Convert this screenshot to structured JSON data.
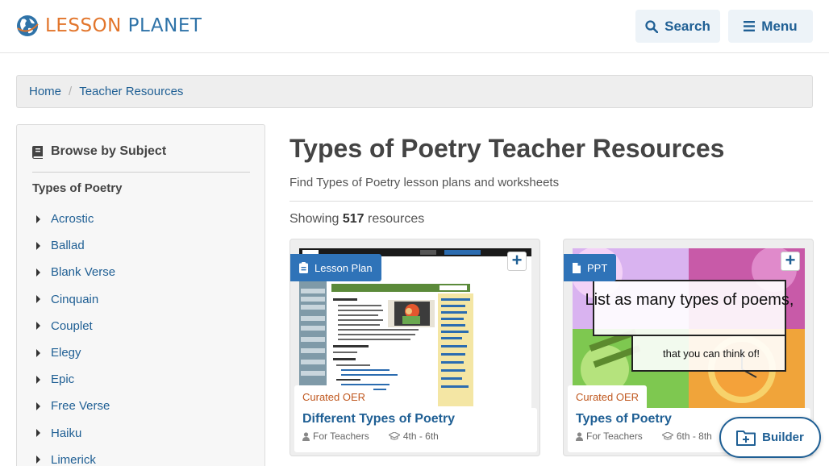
{
  "header": {
    "logo_part1": "LESSON",
    "logo_part2": "PLANET",
    "search_label": "Search",
    "menu_label": "Menu"
  },
  "breadcrumb": {
    "items": [
      "Home",
      "Teacher Resources"
    ],
    "separator": "/"
  },
  "sidebar": {
    "heading": "Browse by Subject",
    "subheading": "Types of Poetry",
    "items": [
      "Acrostic",
      "Ballad",
      "Blank Verse",
      "Cinquain",
      "Couplet",
      "Elegy",
      "Epic",
      "Free Verse",
      "Haiku",
      "Limerick"
    ]
  },
  "main": {
    "title": "Types of Poetry Teacher Resources",
    "subtitle": "Find Types of Poetry lesson plans and worksheets",
    "showing_prefix": "Showing",
    "showing_count": "517",
    "showing_suffix": "resources"
  },
  "cards": [
    {
      "type": "Lesson Plan",
      "tag": "Curated OER",
      "title": "Different Types of Poetry",
      "audience": "For Teachers",
      "grades": "4th - 6th",
      "add_label": "+"
    },
    {
      "type": "PPT",
      "tag": "Curated OER",
      "title": "Types of Poetry",
      "audience": "For Teachers",
      "grades": "6th - 8th",
      "add_label": "+",
      "thumb_text_1": "List as many types of poems,",
      "thumb_text_2": "that you can think of!"
    }
  ],
  "builder": {
    "label": "Builder"
  },
  "colors": {
    "brand_blue": "#1f5f94",
    "brand_orange": "#e2752b",
    "badge_blue": "#2f73b8",
    "oer_orange": "#c0581f"
  }
}
